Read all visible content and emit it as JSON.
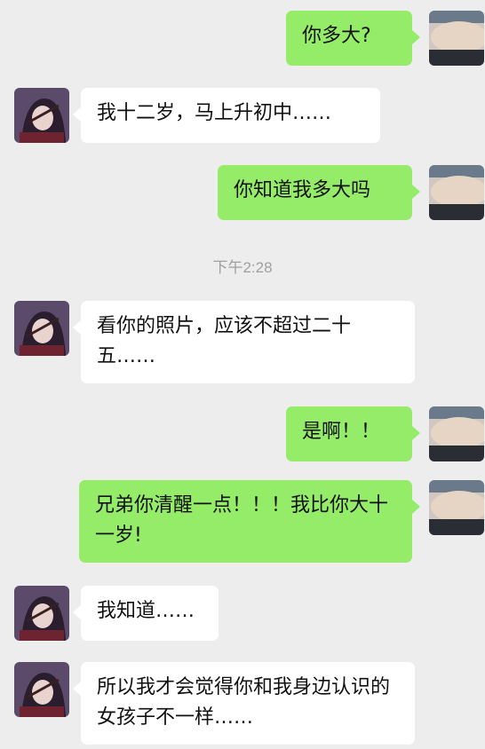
{
  "conversation": {
    "timestamp": "下午2:28",
    "messages": [
      {
        "sender": "me",
        "text": "你多大?"
      },
      {
        "sender": "other",
        "text": "我十二岁，马上升初中……"
      },
      {
        "sender": "me",
        "text": "你知道我多大吗"
      },
      {
        "sender": "other",
        "text": "看你的照片，应该不超过二十五……"
      },
      {
        "sender": "me",
        "text": "是啊！！"
      },
      {
        "sender": "me",
        "text": "兄弟你清醒一点！！！我比你大十一岁!"
      },
      {
        "sender": "other",
        "text": "我知道……"
      },
      {
        "sender": "other",
        "text": "所以我才会觉得你和我身边认识的女孩子不一样……"
      }
    ]
  },
  "avatars": {
    "me": {
      "icon": "photo-avatar-icon"
    },
    "other": {
      "icon": "anime-character-avatar-icon"
    }
  },
  "colors": {
    "background": "#ededed",
    "incoming_bubble": "#ffffff",
    "outgoing_bubble": "#95ec69",
    "timestamp_text": "#a0a0a0"
  }
}
